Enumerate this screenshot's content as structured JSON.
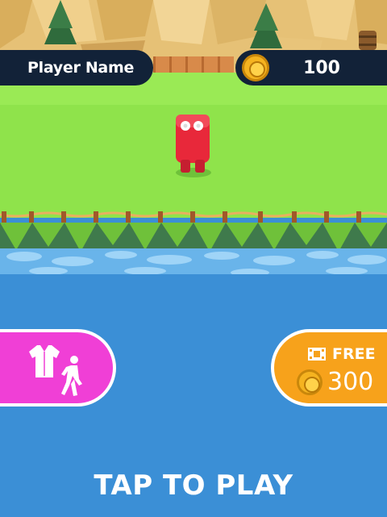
{
  "hud": {
    "player_name": "Player Name",
    "coins": "100"
  },
  "buttons": {
    "skins_icons": [
      "shirt-icon",
      "walking-person-icon"
    ],
    "free_label": "FREE",
    "free_reward": "300"
  },
  "prompt": {
    "tap_to_play": "TAP TO PLAY"
  },
  "colors": {
    "hud_background": "#122238",
    "grass": "#8fe34b",
    "water": "#3b8fd6",
    "skin_button": "#f03fd6",
    "free_button": "#f7a21b",
    "coin": "#f5b320",
    "character": "#e8283a"
  }
}
